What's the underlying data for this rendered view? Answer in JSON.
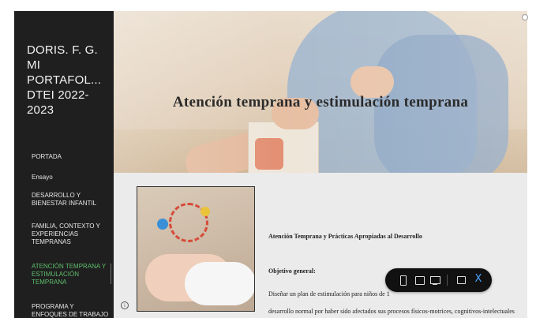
{
  "site": {
    "title": "DORIS. F. G.\nMI\nPORTAFOL...\nDTEI 2022-\n2023"
  },
  "nav": {
    "items": [
      {
        "label": "PORTADA",
        "active": false
      },
      {
        "label": "Ensayo",
        "active": false
      },
      {
        "label": "DESARROLLO Y BIENESTAR INFANTIL",
        "active": false
      },
      {
        "label": "FAMILIA, CONTEXTO Y EXPERIENCIAS TEMPRANAS",
        "active": false
      },
      {
        "label": "ATENCIÓN TEMPRANA Y ESTIMULACIÓN TEMPRANA",
        "active": true
      },
      {
        "label": "PROGRAMA Y ENFOQUES DE TRABAJO",
        "active": false
      }
    ]
  },
  "hero": {
    "title": "Atención  temprana y estimulación temprana"
  },
  "content": {
    "heading": "Atención Temprana y Prácticas Apropiadas al Desarrollo",
    "subheading": "Objetivo general:",
    "paragraph_line1": "Diseñar un plan de estimulación para niños de 1",
    "paragraph_line2": "desarrollo normal por haber sido afectados sus procesos físicos-motrices, cognitivos-intelectuales",
    "info_icon_label": "i"
  },
  "toolbar": {
    "close_label": "X"
  },
  "colors": {
    "sidebar_bg": "#1f1f1f",
    "active_nav": "#5fbf6e",
    "content_bg": "#ebebeb",
    "toolbar_close": "#4aa3ff"
  }
}
